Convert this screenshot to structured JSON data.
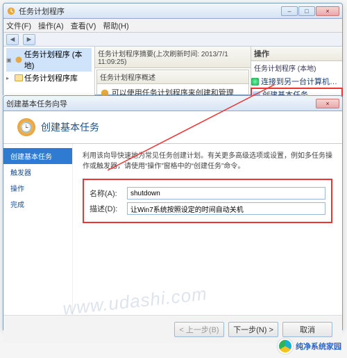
{
  "main": {
    "title": "任务计划程序",
    "menu": {
      "file": "文件(F)",
      "action": "操作(A)",
      "view": "查看(V)",
      "help": "帮助(H)"
    },
    "tree": {
      "root": "任务计划程序 (本地)",
      "child": "任务计划程序库"
    },
    "center": {
      "summary": "任务计划程序摘要(上次刷新时间: 2013/7/1 11:09:25)",
      "overview_title": "任务计划程序概述",
      "overview_text": "可以使用任务计划程序来创建和管理"
    },
    "actions": {
      "title": "操作",
      "group": "任务计划程序 (本地)",
      "connect": "连接到另一台计算机…",
      "create_basic": "创建基本任务…"
    },
    "winbtn": {
      "min": "–",
      "max": "□",
      "close": "×"
    }
  },
  "wizard": {
    "title": "创建基本任务向导",
    "head": "创建基本任务",
    "close": "×",
    "intro": "利用该向导快速地为常见任务创建计划。有关更多高级选项或设置，例如多任务操作或触发器，请使用“操作”窗格中的“创建任务”命令。",
    "steps": {
      "s1": "创建基本任务",
      "s2": "触发器",
      "s3": "操作",
      "s4": "完成"
    },
    "form": {
      "name_label": "名称(A):",
      "name_value": "shutdown",
      "desc_label": "描述(D):",
      "desc_value": "让Win7系统按照设定的时间自动关机"
    },
    "buttons": {
      "back": "< 上一步(B)",
      "next": "下一步(N) >",
      "cancel": "取消"
    }
  },
  "watermark": "www.udashi.com",
  "brand": "纯净系统家园"
}
